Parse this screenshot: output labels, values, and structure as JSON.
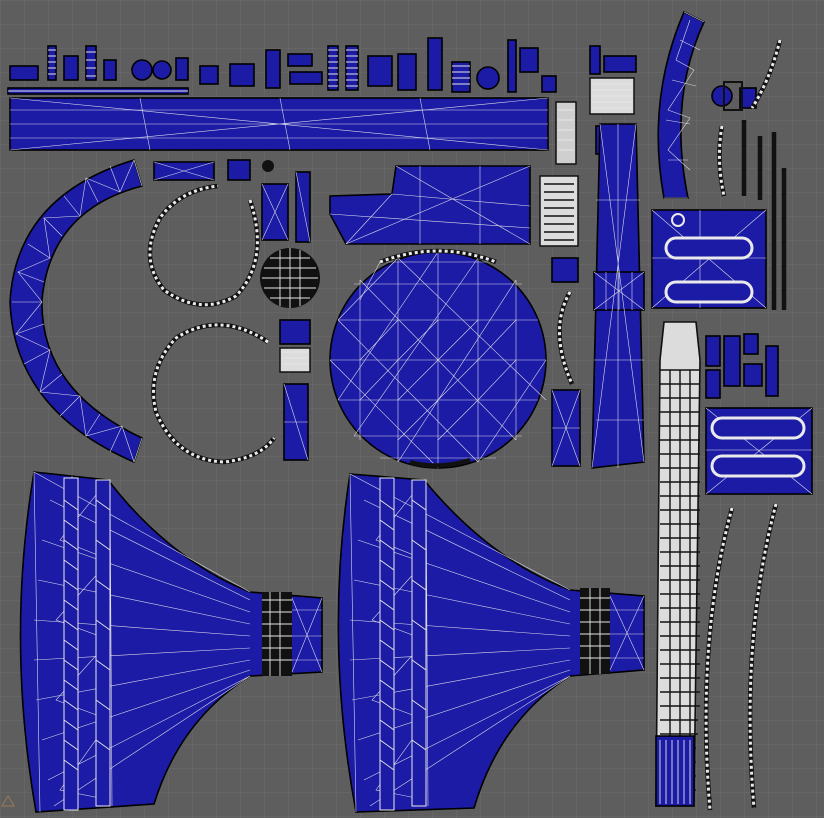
{
  "editor": {
    "view": "UV map",
    "background_color": "#5e5e5e",
    "grid_line_color": "#6c6c6c",
    "island_fill_color": "#1c1ba6",
    "edge_color": "#000000",
    "wire_color": "#d8d8e8"
  }
}
